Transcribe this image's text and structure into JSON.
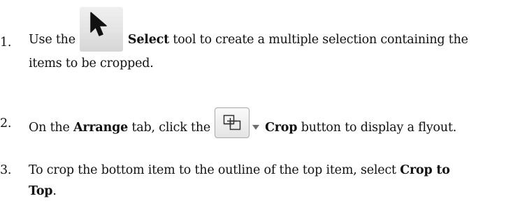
{
  "steps": [
    {
      "number": "1.",
      "use_the": "Use the",
      "select_icon": "select-arrow-icon",
      "select_bold": "Select",
      "rest": " tool to create a multiple selection containing the",
      "line2": "items to be cropped."
    },
    {
      "number": "2.",
      "on_the": "On the ",
      "arrange_bold": "Arrange",
      "tab_click": " tab, click the",
      "crop_icon": "crop-icon",
      "crop_bold": "Crop",
      "rest": " button to display a flyout."
    },
    {
      "number": "3.",
      "text": "To crop the bottom item to the outline of the top item, select ",
      "crop_to_bold": "Crop to",
      "line2_bold": "Top",
      "line2_end": "."
    }
  ]
}
